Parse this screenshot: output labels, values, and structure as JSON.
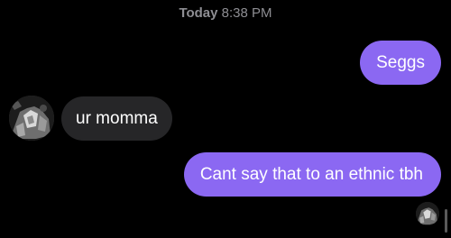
{
  "header": {
    "day": "Today",
    "time": "8:38 PM"
  },
  "messages": [
    {
      "direction": "outgoing",
      "text": "Seggs"
    },
    {
      "direction": "incoming",
      "text": "ur momma"
    },
    {
      "direction": "outgoing",
      "text": "Cant say that to an ethnic tbh"
    }
  ],
  "icons": {
    "contact_avatar": "contact-avatar-icon",
    "read_receipt": "read-receipt-avatar-icon"
  },
  "colors": {
    "background": "#000000",
    "outgoing_bubble": "#8b68f2",
    "incoming_bubble": "#262628",
    "timestamp_text": "#8e8e93"
  }
}
